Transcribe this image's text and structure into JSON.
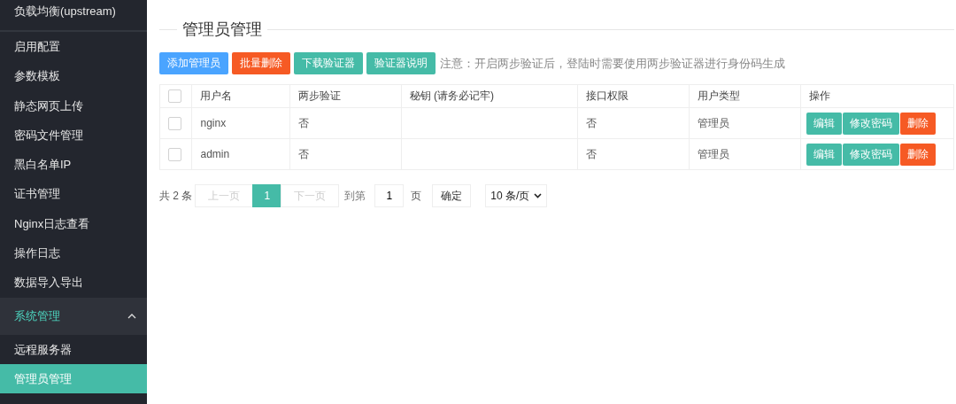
{
  "sidebar": {
    "items": [
      {
        "kind": "item",
        "label": "负载均衡(upstream)",
        "selected": false
      },
      {
        "kind": "item",
        "label": "启用配置",
        "selected": false
      },
      {
        "kind": "item",
        "label": "参数模板",
        "selected": false
      },
      {
        "kind": "item",
        "label": "静态网页上传",
        "selected": false
      },
      {
        "kind": "item",
        "label": "密码文件管理",
        "selected": false
      },
      {
        "kind": "item",
        "label": "黑白名单IP",
        "selected": false
      },
      {
        "kind": "item",
        "label": "证书管理",
        "selected": false
      },
      {
        "kind": "item",
        "label": "Nginx日志查看",
        "selected": false
      },
      {
        "kind": "item",
        "label": "操作日志",
        "selected": false
      },
      {
        "kind": "item",
        "label": "数据导入导出",
        "selected": false
      },
      {
        "kind": "group",
        "label": "系统管理",
        "expanded": true,
        "children": [
          {
            "label": "远程服务器",
            "selected": false
          },
          {
            "label": "管理员管理",
            "selected": true
          }
        ]
      }
    ]
  },
  "page_title": "管理员管理",
  "toolbar": {
    "buttons": [
      {
        "label": "添加管理员",
        "kind": "primary"
      },
      {
        "label": "批量删除",
        "kind": "danger"
      },
      {
        "label": "下载验证器",
        "kind": "normal"
      },
      {
        "label": "验证器说明",
        "kind": "normal"
      }
    ],
    "note": "注意：开启两步验证后，登陆时需要使用两步验证器进行身份码生成"
  },
  "table": {
    "header_checked": false,
    "columns": [
      "用户名",
      "两步验证",
      "秘钥 (请务必记牢)",
      "接口权限",
      "用户类型",
      "操作"
    ],
    "rows": [
      {
        "checked": false,
        "cells": [
          "nginx",
          "否",
          "",
          "否",
          "管理员"
        ],
        "actions": [
          {
            "label": "编辑",
            "kind": "normal"
          },
          {
            "label": "修改密码",
            "kind": "normal"
          },
          {
            "label": "删除",
            "kind": "danger"
          }
        ]
      },
      {
        "checked": false,
        "cells": [
          "admin",
          "否",
          "",
          "否",
          "管理员"
        ],
        "actions": [
          {
            "label": "编辑",
            "kind": "normal"
          },
          {
            "label": "修改密码",
            "kind": "normal"
          },
          {
            "label": "删除",
            "kind": "danger"
          }
        ]
      }
    ]
  },
  "pagination": {
    "total": "共 2 条",
    "prev": "上一页",
    "pages": [
      {
        "label": "1",
        "selected": true
      }
    ],
    "next": "下一页",
    "goto_label": "到第",
    "goto_value": "1",
    "page_unit": "页",
    "confirm": "确定",
    "page_size": "10 条/页"
  }
}
